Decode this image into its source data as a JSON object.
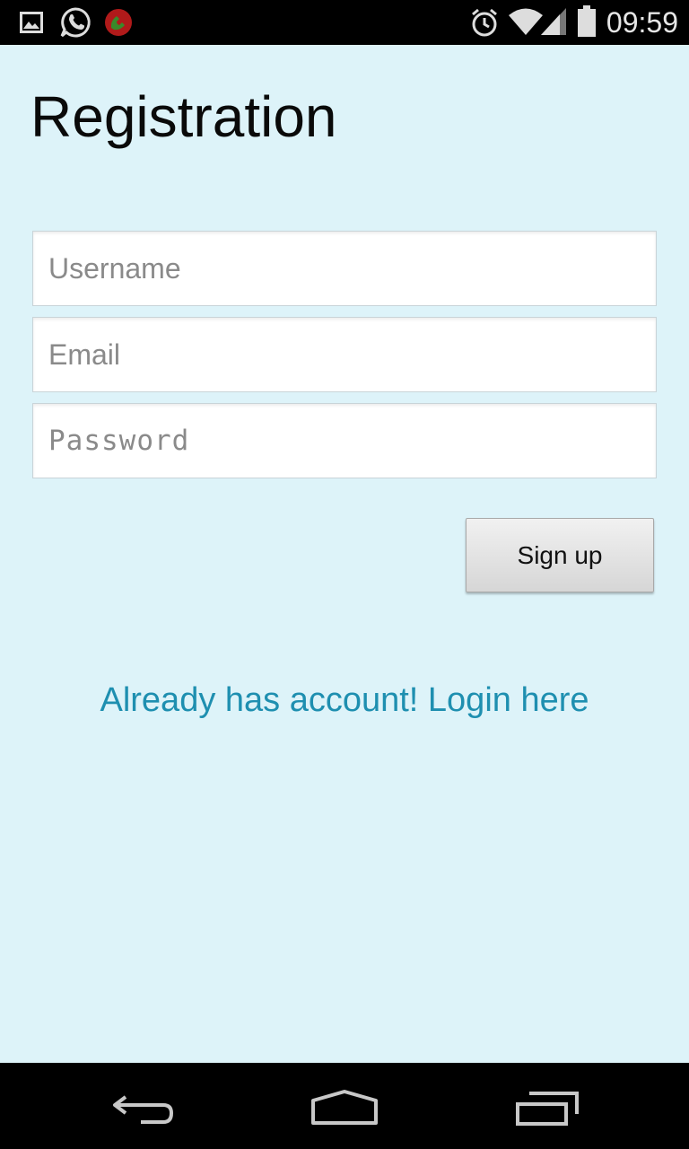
{
  "status_bar": {
    "time": "09:59",
    "left_icons": [
      "gallery-icon",
      "whatsapp-icon",
      "missed-call-icon"
    ],
    "right_icons": [
      "alarm-icon",
      "wifi-icon",
      "signal-icon",
      "battery-icon"
    ]
  },
  "app": {
    "title": "Registration",
    "background_color": "#ddf3f9",
    "form": {
      "username_placeholder": "Username",
      "email_placeholder": "Email",
      "password_placeholder": "Password",
      "signup_label": "Sign up"
    },
    "login_link": "Already has account! Login here",
    "link_color": "#1e8fb0"
  },
  "nav_bar": {
    "buttons": [
      "back-icon",
      "home-icon",
      "recents-icon"
    ]
  }
}
